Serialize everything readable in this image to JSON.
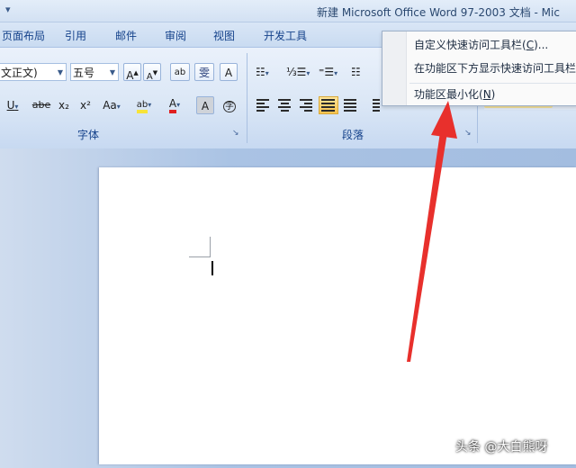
{
  "window": {
    "title": "新建 Microsoft Office Word 97-2003 文档 - Mic",
    "qat_glyph": "▾"
  },
  "tabs": [
    {
      "label": "页面布局"
    },
    {
      "label": "引用"
    },
    {
      "label": "邮件"
    },
    {
      "label": "审阅"
    },
    {
      "label": "视图"
    },
    {
      "label": "开发工具"
    }
  ],
  "font_group": {
    "font_name": "文正文)",
    "font_size": "五号",
    "grow_font": "A",
    "shrink_font": "A",
    "char_ruby": "ab",
    "phonetic": "雯",
    "char_border": "A",
    "underline": "U",
    "strikethrough": "abe",
    "subscript": "x₂",
    "superscript": "x²",
    "change_case": "Aa",
    "highlight": "ab",
    "font_color": "A",
    "char_shading": "A",
    "enclose": "字",
    "label": "字体",
    "launcher": "↘"
  },
  "paragraph_group": {
    "bullets": "☷",
    "numbering": "⅓☰",
    "multilevel": "⁼☰",
    "indent": "☷",
    "label": "段落",
    "launcher": "↘"
  },
  "context_menu": {
    "items": [
      {
        "text": "自定义快速访问工具栏(C)...",
        "prefix": "自定义快速访问工具栏(",
        "key": "C",
        "suffix": ")..."
      },
      {
        "text": "在功能区下方显示快速访问工具栏",
        "prefix": "在功能区下方显示快速访问工具栏",
        "key": "",
        "suffix": ""
      },
      {
        "text": "功能区最小化(N)",
        "prefix": "功能区最小化(",
        "key": "N",
        "suffix": ")"
      }
    ]
  },
  "annotation": {
    "arrow_color": "#e8302c"
  },
  "watermark": {
    "text": "头条 @大白熊呀"
  },
  "colors": {
    "ribbon": "#dbe7f6",
    "workspace": "#aac3e4",
    "highlight_yellow": "#f7e339",
    "font_red": "#e02020"
  }
}
